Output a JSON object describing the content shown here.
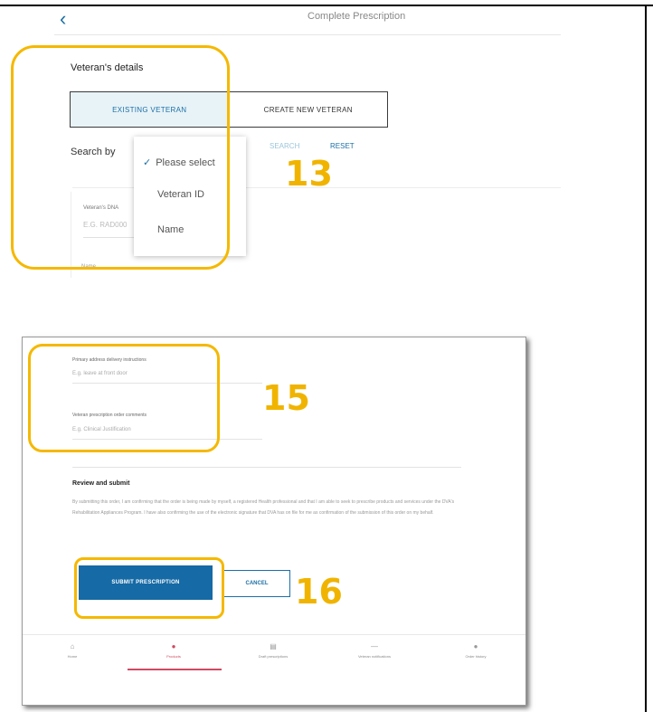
{
  "top_screen": {
    "title": "Complete Prescription",
    "section_title": "Veteran's details",
    "segmented": {
      "existing": "EXISTING VETERAN",
      "create": "CREATE NEW VETERAN"
    },
    "search_by_label": "Search by",
    "search_link": "SEARCH",
    "reset_link": "RESET",
    "dropdown_options": [
      "Please select",
      "Veteran ID",
      "Name"
    ],
    "selected_option": "Please select",
    "field_label": "Veteran's DNA",
    "field_placeholder": "E.G. RAD000",
    "field_label_2": "Name"
  },
  "callouts": {
    "c13": "13",
    "c15": "15",
    "c16": "16"
  },
  "bottom_screen": {
    "field1_label": "Primary address delivery instructions",
    "field1_placeholder": "E.g. leave at front door",
    "field2_label": "Veteran prescription order comments",
    "field2_placeholder": "E.g. Clinical Justification",
    "review_title": "Review and submit",
    "review_text": "By submitting this order, I am confirming that the order is being made by myself, a registered Health professional and that I am able to seek to prescribe products and services under the DVA's Rehabilitation Appliances Program. I have also confirming the use of the electronic signature that DVA has on file for me as confirmation of the submission of this order on my behalf.",
    "submit_label": "SUBMIT PRESCRIPTION",
    "cancel_label": "CANCEL",
    "nav": [
      {
        "label": "Home",
        "icon": "home-icon",
        "glyph": "⌂"
      },
      {
        "label": "Products",
        "icon": "products-icon",
        "glyph": "●"
      },
      {
        "label": "Draft prescriptions",
        "icon": "drafts-icon",
        "glyph": "▤"
      },
      {
        "label": "Veteran notifications",
        "icon": "notifications-icon",
        "glyph": "—"
      },
      {
        "label": "Order history",
        "icon": "order-history-icon",
        "glyph": "●"
      }
    ],
    "active_nav": "Products"
  },
  "colors": {
    "accent": "#1b6fa7",
    "callout": "#f5b800",
    "active_nav": "#d04a60"
  }
}
